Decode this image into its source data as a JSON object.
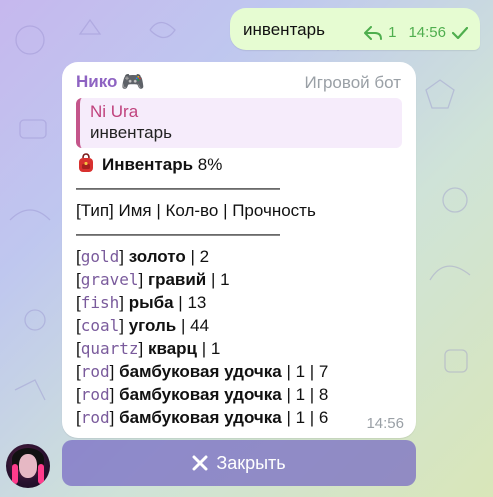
{
  "outgoing": {
    "text": "инвентарь",
    "reply_count": "1",
    "time": "14:56"
  },
  "incoming": {
    "sender_name": "Нико",
    "sender_emoji": "🎮",
    "bot_label": "Игровой бот",
    "reply": {
      "author": "Ni Ura",
      "text": "инвентарь"
    },
    "title": "Инвентарь",
    "title_percent": "8%",
    "separator": "————————————",
    "header": "[Тип] Имя | Кол-во | Прочность",
    "items": [
      {
        "tag": "gold",
        "name": "золото",
        "rest": " | 2"
      },
      {
        "tag": "gravel",
        "name": "гравий",
        "rest": " | 1"
      },
      {
        "tag": "fish",
        "name": "рыба",
        "rest": " | 13"
      },
      {
        "tag": "coal",
        "name": "уголь",
        "rest": " | 44"
      },
      {
        "tag": "quartz",
        "name": "кварц",
        "rest": " | 1"
      },
      {
        "tag": "rod",
        "name": "бамбуковая удочка",
        "rest": " | 1 | 7"
      },
      {
        "tag": "rod",
        "name": "бамбуковая удочка",
        "rest": " | 1 | 8"
      },
      {
        "tag": "rod",
        "name": "бамбуковая удочка",
        "rest": " | 1 | 6"
      }
    ],
    "time": "14:56"
  },
  "close_button": {
    "label": "Закрыть"
  },
  "icons": {
    "reply": "reply-arrow-icon",
    "check": "check-icon",
    "bag": "backpack-icon",
    "close": "x-icon",
    "avatar": "avatar"
  },
  "colors": {
    "accent_name": "#8e63c2",
    "reply_author": "#c0427d",
    "out_meta": "#4fae4e",
    "button": "#7668c4"
  }
}
